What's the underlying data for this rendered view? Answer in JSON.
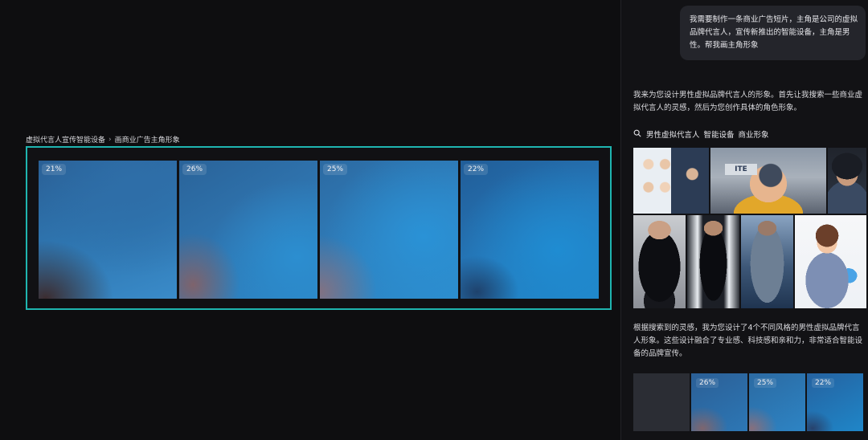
{
  "canvas": {
    "breadcrumb": {
      "parent": "虚拟代言人宣传智能设备",
      "separator": "›",
      "current": "画商业广告主角形象"
    },
    "thumbnails": [
      {
        "progress_label": "21%",
        "progress": 21
      },
      {
        "progress_label": "26%",
        "progress": 26
      },
      {
        "progress_label": "25%",
        "progress": 25
      },
      {
        "progress_label": "22%",
        "progress": 22
      }
    ],
    "frame_color": "#1fb5b0"
  },
  "chat": {
    "user_message": "我需要制作一条商业广告短片，主角是公司的虚拟品牌代言人，宣传新推出的智能设备，主角是男性。帮我画主角形象",
    "ai_intro": "我来为您设计男性虚拟品牌代言人的形象。首先让我搜索一些商业虚拟代言人的灵感，然后为您创作具体的角色形象。",
    "search": {
      "icon": "search-icon",
      "terms": [
        "男性虚拟代言人",
        "智能设备",
        "商业形象"
      ]
    },
    "reference_image_sign": "ITE",
    "ai_result": "根据搜索到的灵感，我为您设计了4个不同风格的男性虚拟品牌代言人形象。这些设计融合了专业感、科技感和亲和力，非常适合智能设备的品牌宣传。",
    "result_strip": [
      {
        "progress_label": ""
      },
      {
        "progress_label": "26%"
      },
      {
        "progress_label": "25%"
      },
      {
        "progress_label": "22%"
      }
    ]
  }
}
